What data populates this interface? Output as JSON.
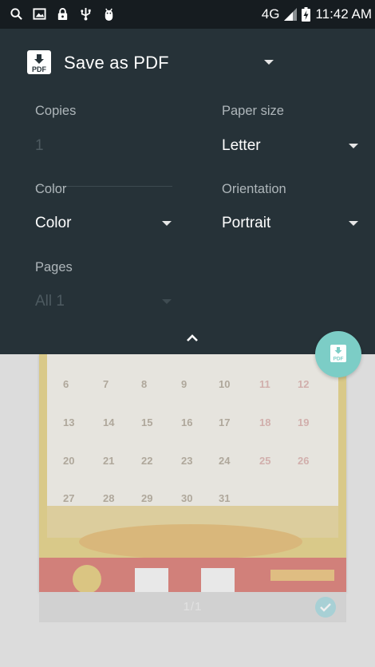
{
  "status_bar": {
    "network": "4G",
    "time": "11:42 AM",
    "icons": [
      "search-icon",
      "image-icon",
      "lock-icon",
      "usb-icon",
      "android-debug-icon",
      "signal-icon",
      "battery-charging-icon"
    ]
  },
  "printer": {
    "name": "Save as PDF",
    "icon": "pdf-icon"
  },
  "options": {
    "copies": {
      "label": "Copies",
      "value": "1"
    },
    "paper_size": {
      "label": "Paper size",
      "value": "Letter"
    },
    "color": {
      "label": "Color",
      "value": "Color"
    },
    "orientation": {
      "label": "Orientation",
      "value": "Portrait"
    },
    "pages": {
      "label": "Pages",
      "value": "All 1"
    }
  },
  "preview": {
    "page_count": "1/1",
    "calendar_rows": [
      [
        "6",
        "7",
        "8",
        "9",
        "10",
        "11",
        "12"
      ],
      [
        "13",
        "14",
        "15",
        "16",
        "17",
        "18",
        "19"
      ],
      [
        "20",
        "21",
        "22",
        "23",
        "24",
        "25",
        "26"
      ],
      [
        "27",
        "28",
        "29",
        "30",
        "31"
      ]
    ]
  },
  "colors": {
    "panel": "#263238",
    "status_bar": "#161c20",
    "fab": "#7ccdc6",
    "background": "#dcdcdc"
  }
}
